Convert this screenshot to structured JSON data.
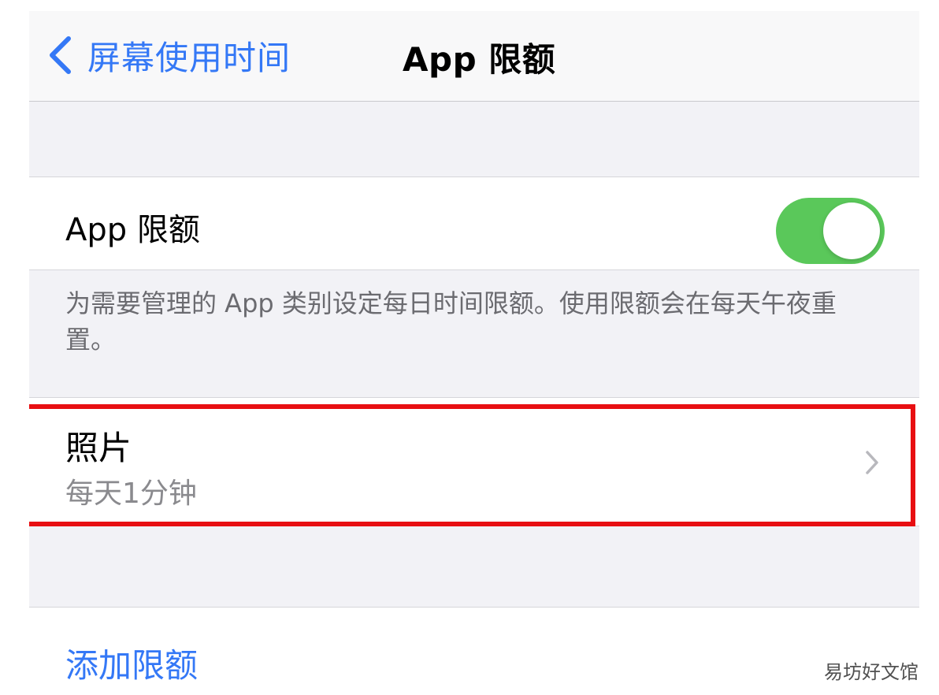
{
  "nav": {
    "back_label": "屏幕使用时间",
    "title": "App 限额"
  },
  "app_limits": {
    "label": "App 限额",
    "enabled": true,
    "footer": "为需要管理的 App 类别设定每日时间限额。使用限额会在每天午夜重置。"
  },
  "limits": [
    {
      "name": "照片",
      "detail": "每天1分钟"
    }
  ],
  "add_limit_label": "添加限额",
  "watermark": "易坊好文馆",
  "colors": {
    "accent": "#3478f6",
    "toggle_on": "#5ac85a",
    "highlight": "#e80f12",
    "background": "#f2f2f6"
  },
  "icons": [
    "chevron-left-icon",
    "chevron-right-icon"
  ]
}
